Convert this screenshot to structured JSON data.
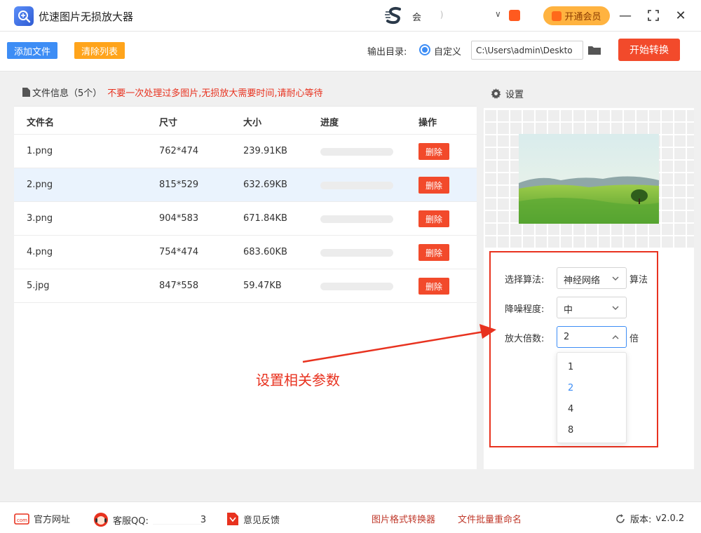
{
  "app": {
    "title": "优速图片无损放大器",
    "user_name": "会",
    "user_masked": "       )",
    "user_caret": "∨",
    "vip_label": "开通会员",
    "minimize": "—",
    "maximize": "⛶",
    "close": "✕"
  },
  "toolbar": {
    "add_files": "添加文件",
    "clear_list": "清除列表",
    "output_label": "输出目录:",
    "radio_custom": "自定义",
    "output_path": "C:\\Users\\admin\\Deskto",
    "start_convert": "开始转换"
  },
  "file_panel": {
    "header_title": "文件信息（5个）",
    "header_warning": "不要一次处理过多图片,无损放大需要时间,请耐心等待",
    "columns": [
      "文件名",
      "尺寸",
      "大小",
      "进度",
      "操作"
    ],
    "delete_label": "删除",
    "rows": [
      {
        "name": "1.png",
        "size": "762*474",
        "filesize": "239.91KB",
        "progress": 0
      },
      {
        "name": "2.png",
        "size": "815*529",
        "filesize": "632.69KB",
        "progress": 0
      },
      {
        "name": "3.png",
        "size": "904*583",
        "filesize": "671.84KB",
        "progress": 0
      },
      {
        "name": "4.png",
        "size": "754*474",
        "filesize": "683.60KB",
        "progress": 0
      },
      {
        "name": "5.jpg",
        "size": "847*558",
        "filesize": "59.47KB",
        "progress": 0
      }
    ]
  },
  "settings": {
    "title": "设置",
    "algorithm_label": "选择算法:",
    "algorithm_value": "神经网络",
    "algorithm_suffix": "算法",
    "denoise_label": "降噪程度:",
    "denoise_value": "中",
    "scale_label": "放大倍数:",
    "scale_value": "2",
    "scale_suffix": "倍",
    "scale_options": [
      "1",
      "2",
      "4",
      "8"
    ]
  },
  "annotation": {
    "text": "设置相关参数"
  },
  "footer": {
    "website": "官方网址",
    "qq_label": "客服QQ:",
    "qq_tail": "3",
    "feedback": "意见反馈",
    "format_converter": "图片格式转换器",
    "batch_rename": "文件批量重命名",
    "version_label": "版本:",
    "version": "v2.0.2"
  },
  "colors": {
    "primary_blue": "#3d8df5",
    "orange": "#ffa41b",
    "red": "#f24a2b",
    "vip": "#ffb340"
  }
}
